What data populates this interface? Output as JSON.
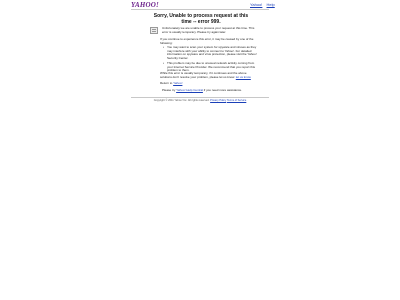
{
  "header": {
    "logo": "YAHOO!",
    "links": [
      "Yahoo!",
      "Help"
    ]
  },
  "main": {
    "title": "Sorry, Unable to process request at this time -- error 999.",
    "intro": "Unfortunately we are unable to process your request at this time. This error is usually temporary. Please try again later.",
    "cause": "If you continue to experience this error, it may be caused by one of the following:",
    "causes": [
      "You may want to scan your system for spyware and viruses as they may interfere with your ability to connect to Yahoo!. For detailed information on spyware and virus protection, please visit the Yahoo! Security Center.",
      "This problem may be due to unusual network activity coming from your Internet Service Provider. We recommend that you report this problem to them."
    ],
    "link_security_center": "Yahoo! Security Center",
    "note_text": "While this error is usually temporary, if it continues and the above solutions don't resolve your problem, please let us know.",
    "note_link": "let us know",
    "return_prefix": "Return to",
    "return_link": "Yahoo!",
    "help_prefix": "Please try",
    "help_link": "Yahoo! Help Central",
    "help_suffix": "if you need more assistance."
  },
  "footer": {
    "copyright": "Copyright © 2011 Yahoo! Inc. All rights reserved.",
    "privacy": "Privacy Policy",
    "terms": "Terms of Service"
  }
}
